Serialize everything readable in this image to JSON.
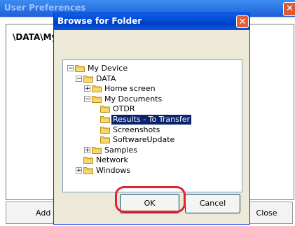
{
  "background_window": {
    "title": "User Preferences",
    "path_text": "\\DATA\\My",
    "left_button_label": "Add a",
    "right_button_label": "Close",
    "close_glyph": "✕"
  },
  "dialog": {
    "title": "Browse for Folder",
    "close_glyph": "✕",
    "ok_label": "OK",
    "cancel_label": "Cancel",
    "accent_color": "#0a246a",
    "highlight_color": "#e52030"
  },
  "tree": {
    "items": [
      {
        "label": "My Device",
        "expander": "⊟",
        "selected": false
      },
      {
        "label": "DATA",
        "expander": "⊟",
        "selected": false
      },
      {
        "label": "Home screen",
        "expander": "⊞",
        "selected": false
      },
      {
        "label": "My Documents",
        "expander": "⊟",
        "selected": false
      },
      {
        "label": "OTDR",
        "expander": "",
        "selected": false
      },
      {
        "label": "Results - To Transfer",
        "expander": "",
        "selected": true
      },
      {
        "label": "Screenshots",
        "expander": "",
        "selected": false
      },
      {
        "label": "SoftwareUpdate",
        "expander": "",
        "selected": false
      },
      {
        "label": "Samples",
        "expander": "⊞",
        "selected": false
      },
      {
        "label": "Network",
        "expander": "",
        "selected": false
      },
      {
        "label": "Windows",
        "expander": "⊞",
        "selected": false
      }
    ]
  }
}
